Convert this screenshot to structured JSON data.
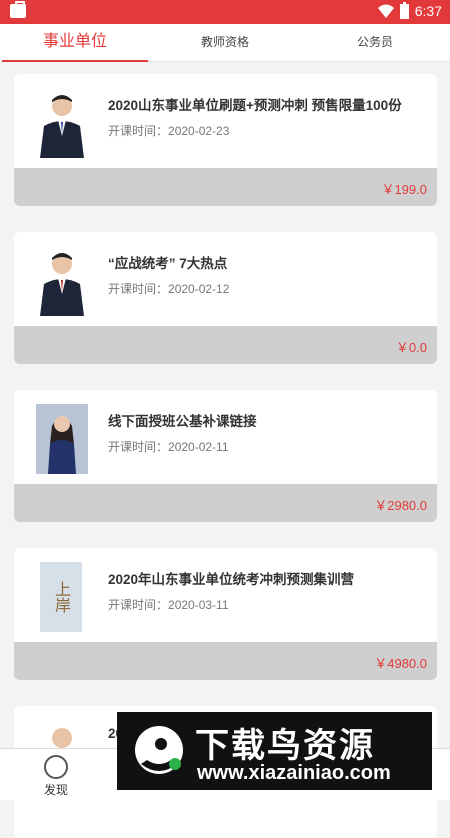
{
  "status": {
    "time": "6:37"
  },
  "tabs": [
    {
      "label": "事业单位",
      "active": true
    },
    {
      "label": "教师资格",
      "active": false
    },
    {
      "label": "公务员",
      "active": false
    }
  ],
  "courses": [
    {
      "title": "2020山东事业单位刷题+预测冲刺 预售限量100份",
      "date_label": "开课时间：",
      "date": "2020-02-23",
      "price": "￥199.0"
    },
    {
      "title": "“应战统考” 7大热点",
      "date_label": "开课时间：",
      "date": "2020-02-12",
      "price": "￥0.0"
    },
    {
      "title": "线下面授班公基补课链接",
      "date_label": "开课时间：",
      "date": "2020-02-11",
      "price": "￥2980.0"
    },
    {
      "title": "2020年山东事业单位统考冲刺预测集训营",
      "date_label": "开课时间：",
      "date": "2020-03-11",
      "price": "￥4980.0"
    },
    {
      "title": "20",
      "date_label": "",
      "date": "",
      "price": ""
    }
  ],
  "thumb4_text": "上岸",
  "bottom_nav": {
    "discover": "发现"
  },
  "banner": {
    "main": "下载鸟资源",
    "url": "www.xiazainiao.com"
  },
  "colors": {
    "accent": "#e23a3a"
  }
}
